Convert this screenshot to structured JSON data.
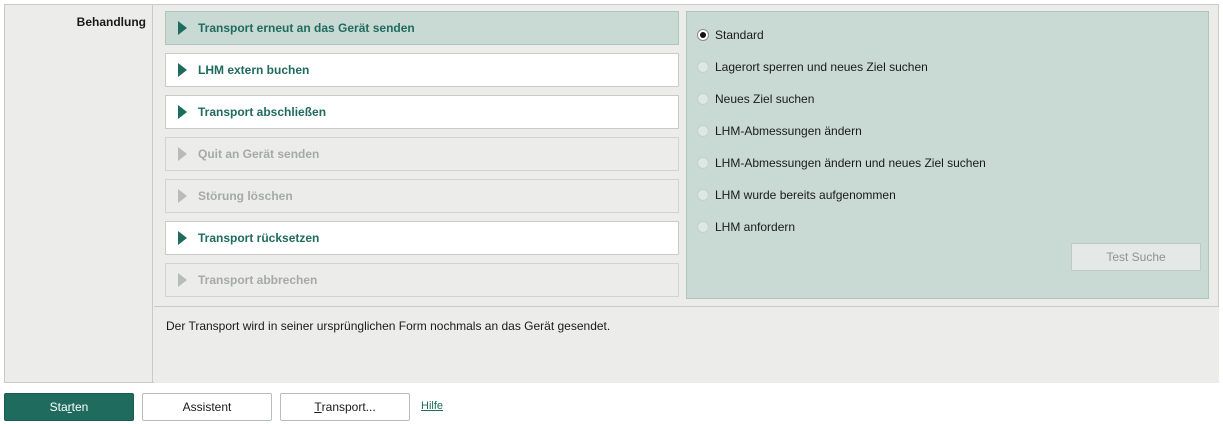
{
  "section": {
    "label": "Behandlung"
  },
  "actions": [
    {
      "label": "Transport erneut an das Gerät senden",
      "state": "selected"
    },
    {
      "label": "LHM extern buchen",
      "state": "enabled"
    },
    {
      "label": "Transport abschließen",
      "state": "enabled"
    },
    {
      "label": "Quit an Gerät senden",
      "state": "disabled"
    },
    {
      "label": "Störung löschen",
      "state": "disabled"
    },
    {
      "label": "Transport rücksetzen",
      "state": "enabled"
    },
    {
      "label": "Transport abbrechen",
      "state": "disabled"
    }
  ],
  "options": [
    {
      "label": "Standard",
      "checked": true
    },
    {
      "label": "Lagerort sperren und neues Ziel suchen",
      "checked": false
    },
    {
      "label": "Neues Ziel suchen",
      "checked": false
    },
    {
      "label": "LHM-Abmessungen ändern",
      "checked": false
    },
    {
      "label": "LHM-Abmessungen ändern und neues Ziel suchen",
      "checked": false
    },
    {
      "label": "LHM wurde bereits aufgenommen",
      "checked": false
    },
    {
      "label": "LHM anfordern",
      "checked": false
    }
  ],
  "test_search": {
    "label": "Test Suche",
    "enabled": false
  },
  "description": "Der Transport wird in seiner ursprünglichen Form nochmals an das Gerät gesendet.",
  "footer": {
    "start_pre": "Sta",
    "start_underlined": "r",
    "start_post": "ten",
    "assistant_label": "Assistent",
    "transport_underlined": "T",
    "transport_rest": "ransport...",
    "help_label": "Hilfe"
  },
  "colors": {
    "accent": "#1f6b5e",
    "selected_bg": "#c9d9d4",
    "panel_bg": "#ecedeb"
  }
}
